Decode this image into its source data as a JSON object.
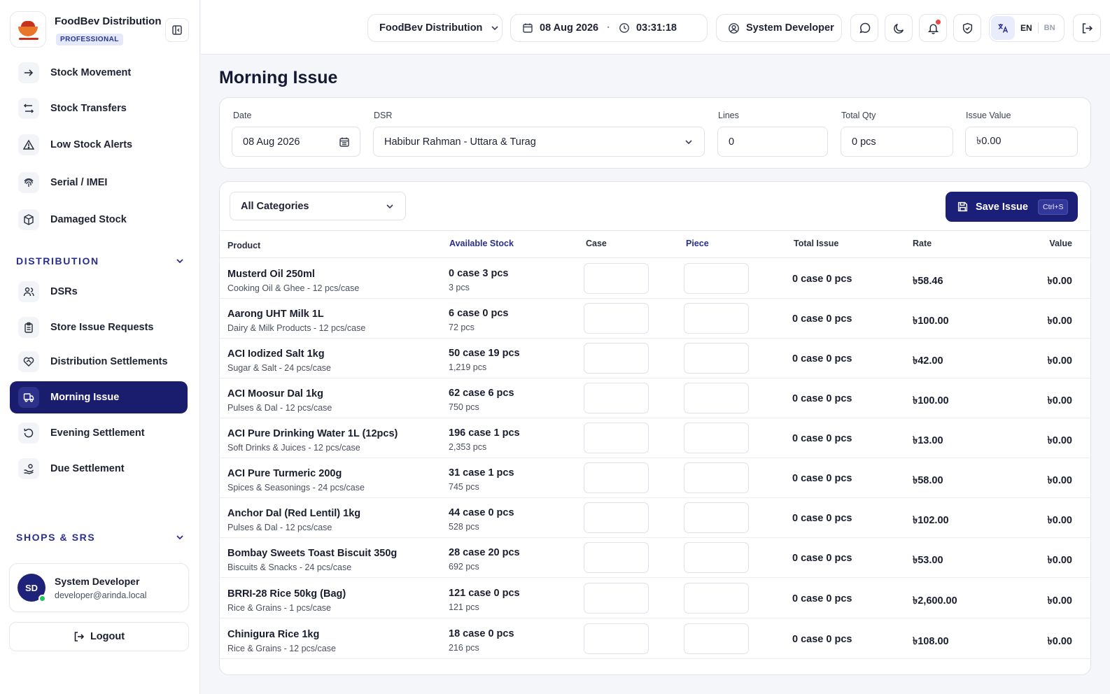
{
  "brand": {
    "name": "FoodBev Distribution",
    "plan": "PROFESSIONAL"
  },
  "nav_top": [
    {
      "label": "Stock Movement",
      "icon": "arrow-right-icon"
    },
    {
      "label": "Stock Transfers",
      "icon": "transfer-arrows-icon"
    },
    {
      "label": "Low Stock Alerts",
      "icon": "warning-triangle-icon"
    },
    {
      "label": "Serial / IMEI",
      "icon": "fingerprint-icon"
    },
    {
      "label": "Damaged Stock",
      "icon": "package-icon"
    }
  ],
  "section_distribution": "DISTRIBUTION",
  "nav_distribution": [
    {
      "label": "DSRs",
      "icon": "users-icon"
    },
    {
      "label": "Store Issue Requests",
      "icon": "clipboard-icon"
    },
    {
      "label": "Distribution Settlements",
      "icon": "handshake-icon"
    },
    {
      "label": "Morning Issue",
      "icon": "truck-icon",
      "active": true
    },
    {
      "label": "Evening Settlement",
      "icon": "rotate-ccw-icon"
    },
    {
      "label": "Due Settlement",
      "icon": "hand-coins-icon"
    }
  ],
  "section_shops": "SHOPS & SRS",
  "user": {
    "initials": "SD",
    "name": "System Developer",
    "email": "developer@arinda.local"
  },
  "logout_label": "Logout",
  "topbar": {
    "company": "FoodBev Distribution",
    "date": "08 Aug 2026",
    "separator": "·",
    "time": "03:31:18",
    "user": "System Developer",
    "lang_en": "EN",
    "lang_bn": "BN"
  },
  "page_title": "Morning Issue",
  "filters": {
    "date_label": "Date",
    "date_value": "08 Aug 2026",
    "dsr_label": "DSR",
    "dsr_value": "Habibur Rahman - Uttara & Turag",
    "lines_label": "Lines",
    "lines_value": "0",
    "total_qty_label": "Total Qty",
    "total_qty_value": "0 pcs",
    "issue_value_label": "Issue Value",
    "issue_value_value": "৳0.00"
  },
  "category_select": "All Categories",
  "save_button": {
    "label": "Save Issue",
    "shortcut": "Ctrl+S"
  },
  "columns": {
    "product": "Product",
    "available": "Available Stock",
    "case": "Case",
    "piece": "Piece",
    "total_issue": "Total Issue",
    "rate": "Rate",
    "value": "Value"
  },
  "rows": [
    {
      "name": "Musterd Oil 250ml",
      "category": "Cooking Oil & Ghee - 12 pcs/case",
      "stock_case": "0 case 3 pcs",
      "stock_pcs": "3 pcs",
      "issue": "0 case 0 pcs",
      "rate": "৳58.46",
      "value": "৳0.00"
    },
    {
      "name": "Aarong UHT Milk 1L",
      "category": "Dairy & Milk Products - 12 pcs/case",
      "stock_case": "6 case 0 pcs",
      "stock_pcs": "72 pcs",
      "issue": "0 case 0 pcs",
      "rate": "৳100.00",
      "value": "৳0.00"
    },
    {
      "name": "ACI Iodized Salt 1kg",
      "category": "Sugar & Salt - 24 pcs/case",
      "stock_case": "50 case 19 pcs",
      "stock_pcs": "1,219 pcs",
      "issue": "0 case 0 pcs",
      "rate": "৳42.00",
      "value": "৳0.00"
    },
    {
      "name": "ACI Moosur Dal 1kg",
      "category": "Pulses & Dal - 12 pcs/case",
      "stock_case": "62 case 6 pcs",
      "stock_pcs": "750 pcs",
      "issue": "0 case 0 pcs",
      "rate": "৳100.00",
      "value": "৳0.00"
    },
    {
      "name": "ACI Pure Drinking Water 1L (12pcs)",
      "category": "Soft Drinks & Juices - 12 pcs/case",
      "stock_case": "196 case 1 pcs",
      "stock_pcs": "2,353 pcs",
      "issue": "0 case 0 pcs",
      "rate": "৳13.00",
      "value": "৳0.00"
    },
    {
      "name": "ACI Pure Turmeric 200g",
      "category": "Spices & Seasonings - 24 pcs/case",
      "stock_case": "31 case 1 pcs",
      "stock_pcs": "745 pcs",
      "issue": "0 case 0 pcs",
      "rate": "৳58.00",
      "value": "৳0.00"
    },
    {
      "name": "Anchor Dal (Red Lentil) 1kg",
      "category": "Pulses & Dal - 12 pcs/case",
      "stock_case": "44 case 0 pcs",
      "stock_pcs": "528 pcs",
      "issue": "0 case 0 pcs",
      "rate": "৳102.00",
      "value": "৳0.00"
    },
    {
      "name": "Bombay Sweets Toast Biscuit 350g",
      "category": "Biscuits & Snacks - 24 pcs/case",
      "stock_case": "28 case 20 pcs",
      "stock_pcs": "692 pcs",
      "issue": "0 case 0 pcs",
      "rate": "৳53.00",
      "value": "৳0.00"
    },
    {
      "name": "BRRI-28 Rice 50kg (Bag)",
      "category": "Rice & Grains - 1 pcs/case",
      "stock_case": "121 case 0 pcs",
      "stock_pcs": "121 pcs",
      "issue": "0 case 0 pcs",
      "rate": "৳2,600.00",
      "value": "৳0.00"
    },
    {
      "name": "Chinigura Rice 1kg",
      "category": "Rice & Grains - 12 pcs/case",
      "stock_case": "18 case 0 pcs",
      "stock_pcs": "216 pcs",
      "issue": "0 case 0 pcs",
      "rate": "৳108.00",
      "value": "৳0.00"
    }
  ]
}
